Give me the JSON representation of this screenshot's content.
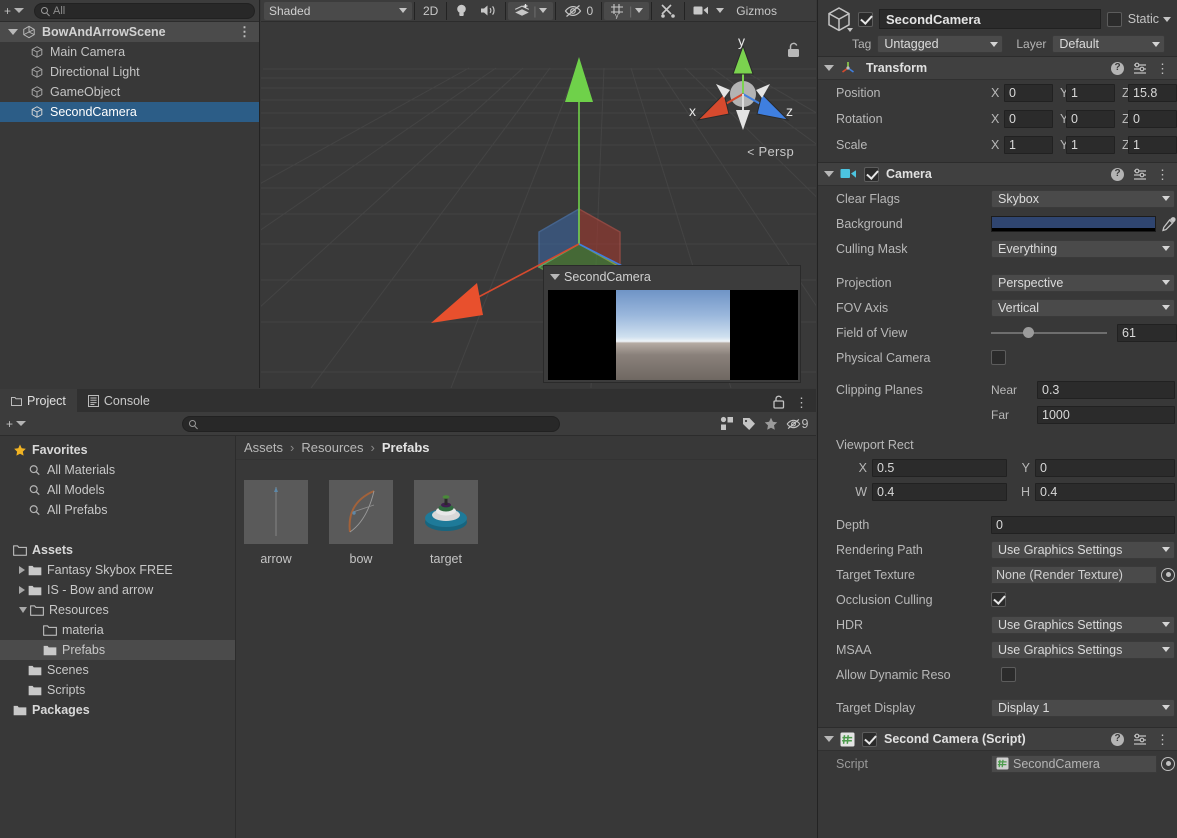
{
  "hierarchy": {
    "search_placeholder": "All",
    "scene": {
      "label": "BowAndArrowScene"
    },
    "items": [
      {
        "label": "Main Camera",
        "selected": false
      },
      {
        "label": "Directional Light",
        "selected": false
      },
      {
        "label": "GameObject",
        "selected": false
      },
      {
        "label": "SecondCamera",
        "selected": true
      }
    ]
  },
  "scene_view": {
    "toolbar": {
      "shading_mode": "Shaded",
      "mode_2d": "2D",
      "lighting_icon": "lightbulb-icon",
      "audio_icon": "speaker-icon",
      "effects_icon": "fx-icon",
      "hidden_objects_count": "0",
      "grid_icon": "grid-icon",
      "tools_icon": "tools-icon",
      "camera_icon": "scene-camera-icon",
      "gizmos": "Gizmos"
    },
    "axis_gizmo": {
      "x": "x",
      "y": "y",
      "z": "z",
      "perspective": "Persp"
    },
    "camera_preview": {
      "title": "SecondCamera"
    }
  },
  "inspector": {
    "object_name": "SecondCamera",
    "enabled": true,
    "static_label": "Static",
    "static_checked": false,
    "tag_label": "Tag",
    "tag_value": "Untagged",
    "layer_label": "Layer",
    "layer_value": "Default",
    "components": [
      {
        "name": "Transform",
        "icon": "transform-icon",
        "rows": [
          {
            "label": "Position",
            "x": "0",
            "y": "1",
            "z": "15.8"
          },
          {
            "label": "Rotation",
            "x": "0",
            "y": "0",
            "z": "0"
          },
          {
            "label": "Scale",
            "x": "1",
            "y": "1",
            "z": "1"
          }
        ]
      }
    ],
    "camera": {
      "title": "Camera",
      "enabled": true,
      "clear_flags_label": "Clear Flags",
      "clear_flags_value": "Skybox",
      "background_label": "Background",
      "background_color": "#2f4570",
      "culling_mask_label": "Culling Mask",
      "culling_mask_value": "Everything",
      "projection_label": "Projection",
      "projection_value": "Perspective",
      "fov_axis_label": "FOV Axis",
      "fov_axis_value": "Vertical",
      "field_of_view_label": "Field of View",
      "field_of_view_value": "61",
      "physical_camera_label": "Physical Camera",
      "physical_camera_checked": false,
      "clipping_planes_label": "Clipping Planes",
      "near_label": "Near",
      "near_value": "0.3",
      "far_label": "Far",
      "far_value": "1000",
      "viewport_rect_label": "Viewport Rect",
      "viewport_x_label": "X",
      "viewport_x": "0.5",
      "viewport_y_label": "Y",
      "viewport_y": "0",
      "viewport_w_label": "W",
      "viewport_w": "0.4",
      "viewport_h_label": "H",
      "viewport_h": "0.4",
      "depth_label": "Depth",
      "depth_value": "0",
      "rendering_path_label": "Rendering Path",
      "rendering_path_value": "Use Graphics Settings",
      "target_texture_label": "Target Texture",
      "target_texture_value": "None (Render Texture)",
      "occlusion_culling_label": "Occlusion Culling",
      "occlusion_culling_checked": true,
      "hdr_label": "HDR",
      "hdr_value": "Use Graphics Settings",
      "msaa_label": "MSAA",
      "msaa_value": "Use Graphics Settings",
      "allow_dynamic_res_label": "Allow Dynamic Reso",
      "allow_dynamic_res_checked": false,
      "target_display_label": "Target Display",
      "target_display_value": "Display 1"
    },
    "script_component": {
      "title": "Second Camera (Script)",
      "enabled": true,
      "script_label": "Script",
      "script_value": "SecondCamera"
    }
  },
  "project": {
    "tabs": [
      {
        "label": "Project",
        "active": true
      },
      {
        "label": "Console",
        "active": false
      }
    ],
    "search_placeholder": "",
    "filter_badge": "9",
    "breadcrumb": [
      "Assets",
      "Resources",
      "Prefabs"
    ],
    "tree": [
      {
        "label": "Favorites",
        "depth": 0,
        "icon": "star-icon",
        "caret": "none",
        "bold": true,
        "selected": false
      },
      {
        "label": "All Materials",
        "depth": 1,
        "icon": "search-icon",
        "caret": "none",
        "bold": false,
        "selected": false
      },
      {
        "label": "All Models",
        "depth": 1,
        "icon": "search-icon",
        "caret": "none",
        "bold": false,
        "selected": false
      },
      {
        "label": "All Prefabs",
        "depth": 1,
        "icon": "search-icon",
        "caret": "none",
        "bold": false,
        "selected": false
      },
      {
        "label": "",
        "depth": 0,
        "icon": "spacer",
        "caret": "none",
        "bold": false,
        "selected": false
      },
      {
        "label": "Assets",
        "depth": 0,
        "icon": "folder-open",
        "caret": "none",
        "bold": true,
        "selected": false
      },
      {
        "label": "Fantasy Skybox FREE",
        "depth": 1,
        "icon": "folder",
        "caret": "closed",
        "bold": false,
        "selected": false
      },
      {
        "label": "IS - Bow and arrow",
        "depth": 1,
        "icon": "folder",
        "caret": "closed",
        "bold": false,
        "selected": false
      },
      {
        "label": "Resources",
        "depth": 1,
        "icon": "folder-open",
        "caret": "open",
        "bold": false,
        "selected": false
      },
      {
        "label": "materia",
        "depth": 2,
        "icon": "folder-empty",
        "caret": "none",
        "bold": false,
        "selected": false
      },
      {
        "label": "Prefabs",
        "depth": 2,
        "icon": "folder",
        "caret": "none",
        "bold": false,
        "selected": true
      },
      {
        "label": "Scenes",
        "depth": 1,
        "icon": "folder",
        "caret": "none",
        "bold": false,
        "selected": false
      },
      {
        "label": "Scripts",
        "depth": 1,
        "icon": "folder",
        "caret": "none",
        "bold": false,
        "selected": false
      },
      {
        "label": "Packages",
        "depth": 0,
        "icon": "folder",
        "caret": "none",
        "bold": true,
        "selected": false
      }
    ],
    "assets": [
      {
        "label": "arrow",
        "icon": "arrow-prefab-thumb"
      },
      {
        "label": "bow",
        "icon": "bow-prefab-thumb"
      },
      {
        "label": "target",
        "icon": "target-prefab-thumb"
      }
    ]
  }
}
